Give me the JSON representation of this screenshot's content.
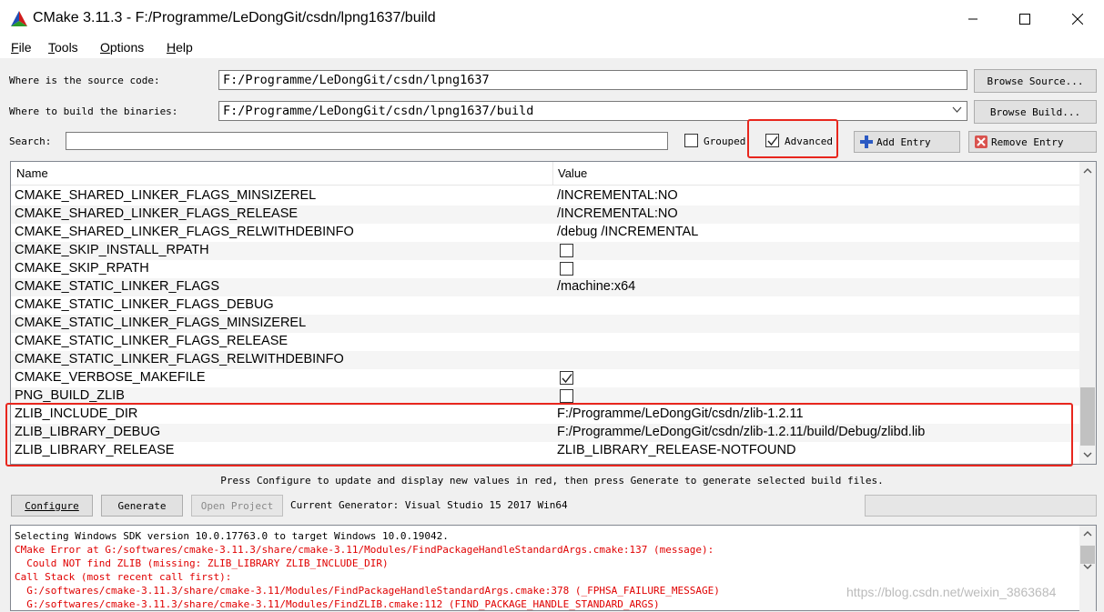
{
  "window": {
    "title": "CMake 3.11.3 - F:/Programme/LeDongGit/csdn/lpng1637/build"
  },
  "menu": {
    "items": [
      {
        "accel": "F",
        "rest": "ile"
      },
      {
        "accel": "T",
        "rest": "ools"
      },
      {
        "accel": "O",
        "rest": "ptions"
      },
      {
        "accel": "H",
        "rest": "elp"
      }
    ]
  },
  "source": {
    "label": "Where is the source code:",
    "value": "F:/Programme/LeDongGit/csdn/lpng1637",
    "browse_label": "Browse Source..."
  },
  "build": {
    "label": "Where to build the binaries:",
    "value": "F:/Programme/LeDongGit/csdn/lpng1637/build",
    "browse_label": "Browse Build..."
  },
  "search": {
    "label": "Search:",
    "value": ""
  },
  "options": {
    "grouped_label": "Grouped",
    "grouped_checked": false,
    "advanced_label": "Advanced",
    "advanced_checked": true,
    "add_entry_label": "Add Entry",
    "remove_entry_label": "Remove Entry"
  },
  "table": {
    "columns": [
      "Name",
      "Value"
    ],
    "rows": [
      {
        "name": "CMAKE_SHARED_LINKER_FLAGS_MINSIZEREL",
        "value": "/INCREMENTAL:NO",
        "type": "text"
      },
      {
        "name": "CMAKE_SHARED_LINKER_FLAGS_RELEASE",
        "value": "/INCREMENTAL:NO",
        "type": "text"
      },
      {
        "name": "CMAKE_SHARED_LINKER_FLAGS_RELWITHDEBINFO",
        "value": "/debug /INCREMENTAL",
        "type": "text"
      },
      {
        "name": "CMAKE_SKIP_INSTALL_RPATH",
        "value": "",
        "type": "bool",
        "checked": false
      },
      {
        "name": "CMAKE_SKIP_RPATH",
        "value": "",
        "type": "bool",
        "checked": false
      },
      {
        "name": "CMAKE_STATIC_LINKER_FLAGS",
        "value": "/machine:x64",
        "type": "text"
      },
      {
        "name": "CMAKE_STATIC_LINKER_FLAGS_DEBUG",
        "value": "",
        "type": "text"
      },
      {
        "name": "CMAKE_STATIC_LINKER_FLAGS_MINSIZEREL",
        "value": "",
        "type": "text"
      },
      {
        "name": "CMAKE_STATIC_LINKER_FLAGS_RELEASE",
        "value": "",
        "type": "text"
      },
      {
        "name": "CMAKE_STATIC_LINKER_FLAGS_RELWITHDEBINFO",
        "value": "",
        "type": "text"
      },
      {
        "name": "CMAKE_VERBOSE_MAKEFILE",
        "value": "",
        "type": "bool",
        "checked": true
      },
      {
        "name": "PNG_BUILD_ZLIB",
        "value": "",
        "type": "bool",
        "checked": false
      },
      {
        "name": "ZLIB_INCLUDE_DIR",
        "value": "F:/Programme/LeDongGit/csdn/zlib-1.2.11",
        "type": "text"
      },
      {
        "name": "ZLIB_LIBRARY_DEBUG",
        "value": "F:/Programme/LeDongGit/csdn/zlib-1.2.11/build/Debug/zlibd.lib",
        "type": "text"
      },
      {
        "name": "ZLIB_LIBRARY_RELEASE",
        "value": "ZLIB_LIBRARY_RELEASE-NOTFOUND",
        "type": "text"
      }
    ]
  },
  "hint": "Press Configure to update and display new values in red, then press Generate to generate selected build files.",
  "actions": {
    "configure_label": "Configure",
    "generate_label": "Generate",
    "open_project_label": "Open Project",
    "generator_text": "Current Generator: Visual Studio 15 2017 Win64"
  },
  "output": {
    "lines": [
      {
        "text": "Selecting Windows SDK version 10.0.17763.0 to target Windows 10.0.19042.",
        "kind": "norm"
      },
      {
        "text": "CMake Error at G:/softwares/cmake-3.11.3/share/cmake-3.11/Modules/FindPackageHandleStandardArgs.cmake:137 (message):",
        "kind": "err"
      },
      {
        "text": "  Could NOT find ZLIB (missing: ZLIB_LIBRARY ZLIB_INCLUDE_DIR)",
        "kind": "err"
      },
      {
        "text": "Call Stack (most recent call first):",
        "kind": "err"
      },
      {
        "text": "  G:/softwares/cmake-3.11.3/share/cmake-3.11/Modules/FindPackageHandleStandardArgs.cmake:378 (_FPHSA_FAILURE_MESSAGE)",
        "kind": "err"
      },
      {
        "text": "  G:/softwares/cmake-3.11.3/share/cmake-3.11/Modules/FindZLIB.cmake:112 (FIND_PACKAGE_HANDLE_STANDARD_ARGS)",
        "kind": "err"
      }
    ]
  },
  "watermark": "https://blog.csdn.net/weixin_3863684"
}
